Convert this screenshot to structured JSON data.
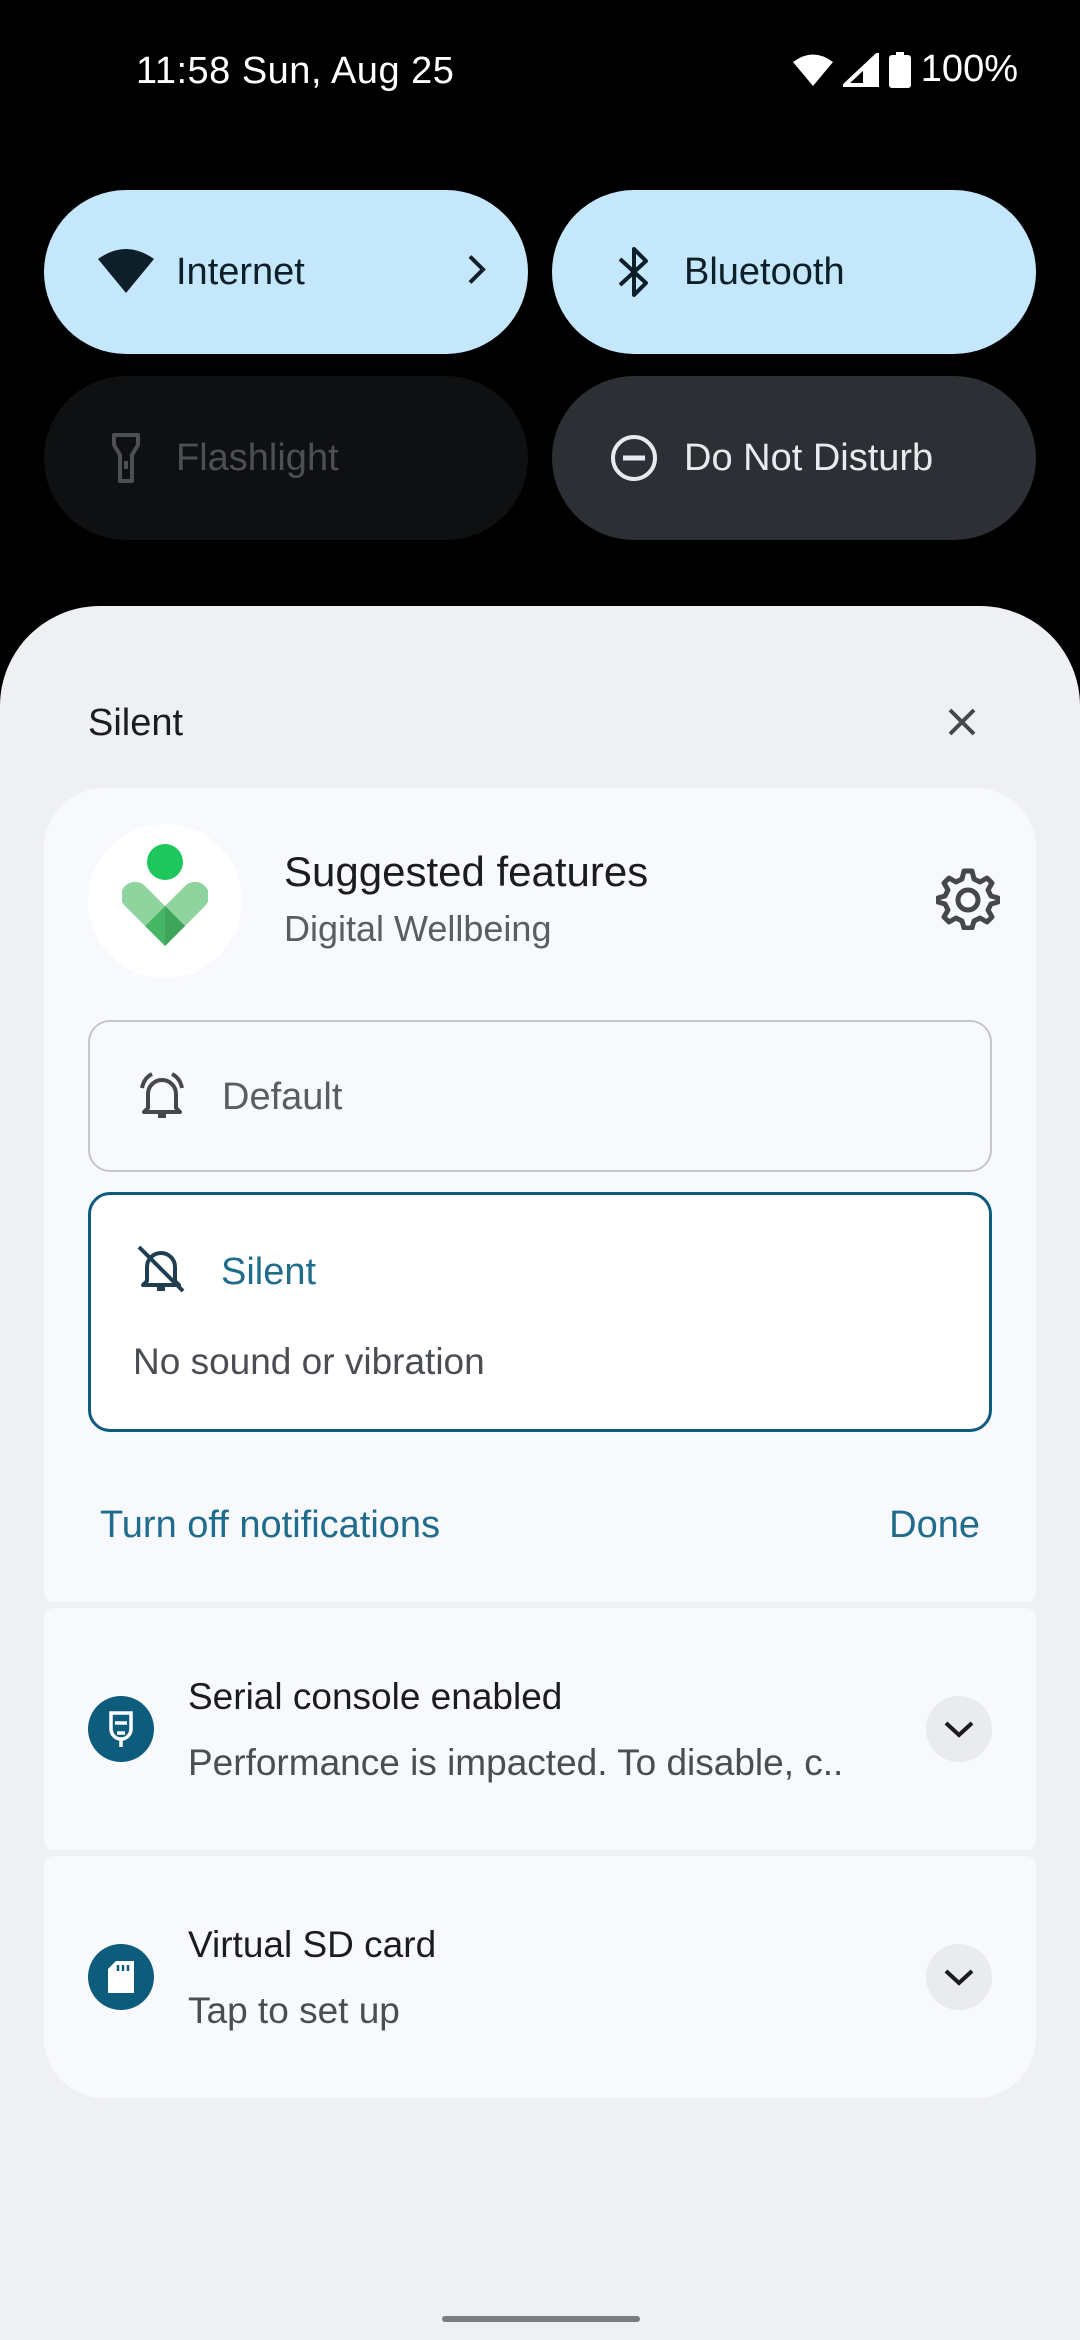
{
  "status_bar": {
    "time_date": "11:58 Sun, Aug 25",
    "battery": "100%",
    "icons": [
      "wifi-icon",
      "cell-signal-icon",
      "battery-icon"
    ]
  },
  "quick_settings": {
    "tiles": [
      {
        "label": "Internet",
        "state": "on",
        "icon": "wifi-icon"
      },
      {
        "label": "Bluetooth",
        "state": "on",
        "icon": "bluetooth-icon"
      },
      {
        "label": "Flashlight",
        "state": "off",
        "icon": "flashlight-icon"
      },
      {
        "label": "Do Not Disturb",
        "state": "off",
        "icon": "do-not-disturb-icon"
      }
    ]
  },
  "shade": {
    "header": "Silent",
    "close_icon": "close-icon"
  },
  "notification_settings": {
    "title": "Suggested features",
    "app_name": "Digital Wellbeing",
    "options": {
      "default_label": "Default",
      "silent_label": "Silent",
      "silent_desc": "No sound or vibration"
    },
    "actions": {
      "turn_off": "Turn off notifications",
      "done": "Done"
    }
  },
  "notifications": [
    {
      "title": "Serial console enabled",
      "text": "Performance is impacted. To disable, c..",
      "icon": "serial-console-icon"
    },
    {
      "title": "Virtual SD card",
      "text": "Tap to set up",
      "icon": "sd-card-icon"
    }
  ],
  "colors": {
    "tile_on": "#c4e7fb",
    "tile_dark": "#2c3034",
    "accent": "#1f6c8c",
    "shade_bg": "#eef0f4"
  }
}
